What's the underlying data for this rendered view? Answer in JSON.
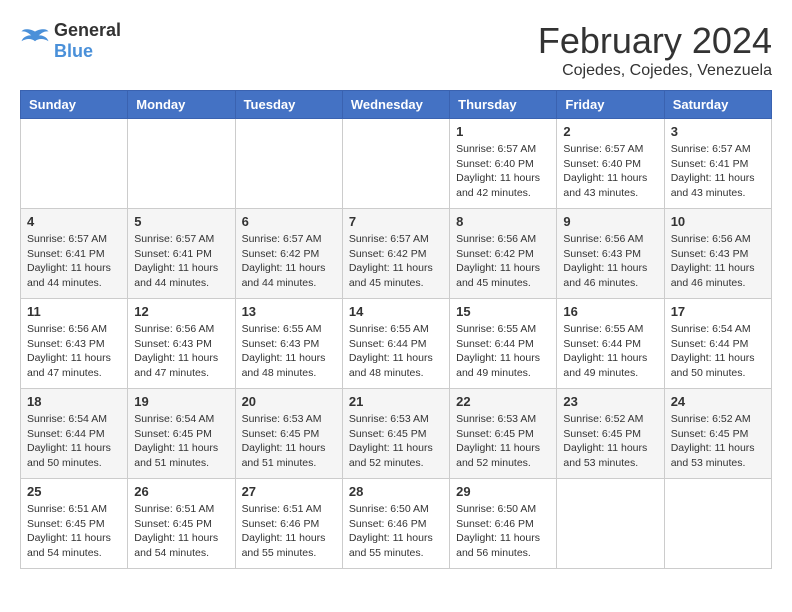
{
  "logo": {
    "general": "General",
    "blue": "Blue"
  },
  "header": {
    "month": "February 2024",
    "location": "Cojedes, Cojedes, Venezuela"
  },
  "weekdays": [
    "Sunday",
    "Monday",
    "Tuesday",
    "Wednesday",
    "Thursday",
    "Friday",
    "Saturday"
  ],
  "weeks": [
    [
      {
        "day": "",
        "sunrise": "",
        "sunset": "",
        "daylight": ""
      },
      {
        "day": "",
        "sunrise": "",
        "sunset": "",
        "daylight": ""
      },
      {
        "day": "",
        "sunrise": "",
        "sunset": "",
        "daylight": ""
      },
      {
        "day": "",
        "sunrise": "",
        "sunset": "",
        "daylight": ""
      },
      {
        "day": "1",
        "sunrise": "Sunrise: 6:57 AM",
        "sunset": "Sunset: 6:40 PM",
        "daylight": "Daylight: 11 hours and 42 minutes."
      },
      {
        "day": "2",
        "sunrise": "Sunrise: 6:57 AM",
        "sunset": "Sunset: 6:40 PM",
        "daylight": "Daylight: 11 hours and 43 minutes."
      },
      {
        "day": "3",
        "sunrise": "Sunrise: 6:57 AM",
        "sunset": "Sunset: 6:41 PM",
        "daylight": "Daylight: 11 hours and 43 minutes."
      }
    ],
    [
      {
        "day": "4",
        "sunrise": "Sunrise: 6:57 AM",
        "sunset": "Sunset: 6:41 PM",
        "daylight": "Daylight: 11 hours and 44 minutes."
      },
      {
        "day": "5",
        "sunrise": "Sunrise: 6:57 AM",
        "sunset": "Sunset: 6:41 PM",
        "daylight": "Daylight: 11 hours and 44 minutes."
      },
      {
        "day": "6",
        "sunrise": "Sunrise: 6:57 AM",
        "sunset": "Sunset: 6:42 PM",
        "daylight": "Daylight: 11 hours and 44 minutes."
      },
      {
        "day": "7",
        "sunrise": "Sunrise: 6:57 AM",
        "sunset": "Sunset: 6:42 PM",
        "daylight": "Daylight: 11 hours and 45 minutes."
      },
      {
        "day": "8",
        "sunrise": "Sunrise: 6:56 AM",
        "sunset": "Sunset: 6:42 PM",
        "daylight": "Daylight: 11 hours and 45 minutes."
      },
      {
        "day": "9",
        "sunrise": "Sunrise: 6:56 AM",
        "sunset": "Sunset: 6:43 PM",
        "daylight": "Daylight: 11 hours and 46 minutes."
      },
      {
        "day": "10",
        "sunrise": "Sunrise: 6:56 AM",
        "sunset": "Sunset: 6:43 PM",
        "daylight": "Daylight: 11 hours and 46 minutes."
      }
    ],
    [
      {
        "day": "11",
        "sunrise": "Sunrise: 6:56 AM",
        "sunset": "Sunset: 6:43 PM",
        "daylight": "Daylight: 11 hours and 47 minutes."
      },
      {
        "day": "12",
        "sunrise": "Sunrise: 6:56 AM",
        "sunset": "Sunset: 6:43 PM",
        "daylight": "Daylight: 11 hours and 47 minutes."
      },
      {
        "day": "13",
        "sunrise": "Sunrise: 6:55 AM",
        "sunset": "Sunset: 6:43 PM",
        "daylight": "Daylight: 11 hours and 48 minutes."
      },
      {
        "day": "14",
        "sunrise": "Sunrise: 6:55 AM",
        "sunset": "Sunset: 6:44 PM",
        "daylight": "Daylight: 11 hours and 48 minutes."
      },
      {
        "day": "15",
        "sunrise": "Sunrise: 6:55 AM",
        "sunset": "Sunset: 6:44 PM",
        "daylight": "Daylight: 11 hours and 49 minutes."
      },
      {
        "day": "16",
        "sunrise": "Sunrise: 6:55 AM",
        "sunset": "Sunset: 6:44 PM",
        "daylight": "Daylight: 11 hours and 49 minutes."
      },
      {
        "day": "17",
        "sunrise": "Sunrise: 6:54 AM",
        "sunset": "Sunset: 6:44 PM",
        "daylight": "Daylight: 11 hours and 50 minutes."
      }
    ],
    [
      {
        "day": "18",
        "sunrise": "Sunrise: 6:54 AM",
        "sunset": "Sunset: 6:44 PM",
        "daylight": "Daylight: 11 hours and 50 minutes."
      },
      {
        "day": "19",
        "sunrise": "Sunrise: 6:54 AM",
        "sunset": "Sunset: 6:45 PM",
        "daylight": "Daylight: 11 hours and 51 minutes."
      },
      {
        "day": "20",
        "sunrise": "Sunrise: 6:53 AM",
        "sunset": "Sunset: 6:45 PM",
        "daylight": "Daylight: 11 hours and 51 minutes."
      },
      {
        "day": "21",
        "sunrise": "Sunrise: 6:53 AM",
        "sunset": "Sunset: 6:45 PM",
        "daylight": "Daylight: 11 hours and 52 minutes."
      },
      {
        "day": "22",
        "sunrise": "Sunrise: 6:53 AM",
        "sunset": "Sunset: 6:45 PM",
        "daylight": "Daylight: 11 hours and 52 minutes."
      },
      {
        "day": "23",
        "sunrise": "Sunrise: 6:52 AM",
        "sunset": "Sunset: 6:45 PM",
        "daylight": "Daylight: 11 hours and 53 minutes."
      },
      {
        "day": "24",
        "sunrise": "Sunrise: 6:52 AM",
        "sunset": "Sunset: 6:45 PM",
        "daylight": "Daylight: 11 hours and 53 minutes."
      }
    ],
    [
      {
        "day": "25",
        "sunrise": "Sunrise: 6:51 AM",
        "sunset": "Sunset: 6:45 PM",
        "daylight": "Daylight: 11 hours and 54 minutes."
      },
      {
        "day": "26",
        "sunrise": "Sunrise: 6:51 AM",
        "sunset": "Sunset: 6:45 PM",
        "daylight": "Daylight: 11 hours and 54 minutes."
      },
      {
        "day": "27",
        "sunrise": "Sunrise: 6:51 AM",
        "sunset": "Sunset: 6:46 PM",
        "daylight": "Daylight: 11 hours and 55 minutes."
      },
      {
        "day": "28",
        "sunrise": "Sunrise: 6:50 AM",
        "sunset": "Sunset: 6:46 PM",
        "daylight": "Daylight: 11 hours and 55 minutes."
      },
      {
        "day": "29",
        "sunrise": "Sunrise: 6:50 AM",
        "sunset": "Sunset: 6:46 PM",
        "daylight": "Daylight: 11 hours and 56 minutes."
      },
      {
        "day": "",
        "sunrise": "",
        "sunset": "",
        "daylight": ""
      },
      {
        "day": "",
        "sunrise": "",
        "sunset": "",
        "daylight": ""
      }
    ]
  ]
}
